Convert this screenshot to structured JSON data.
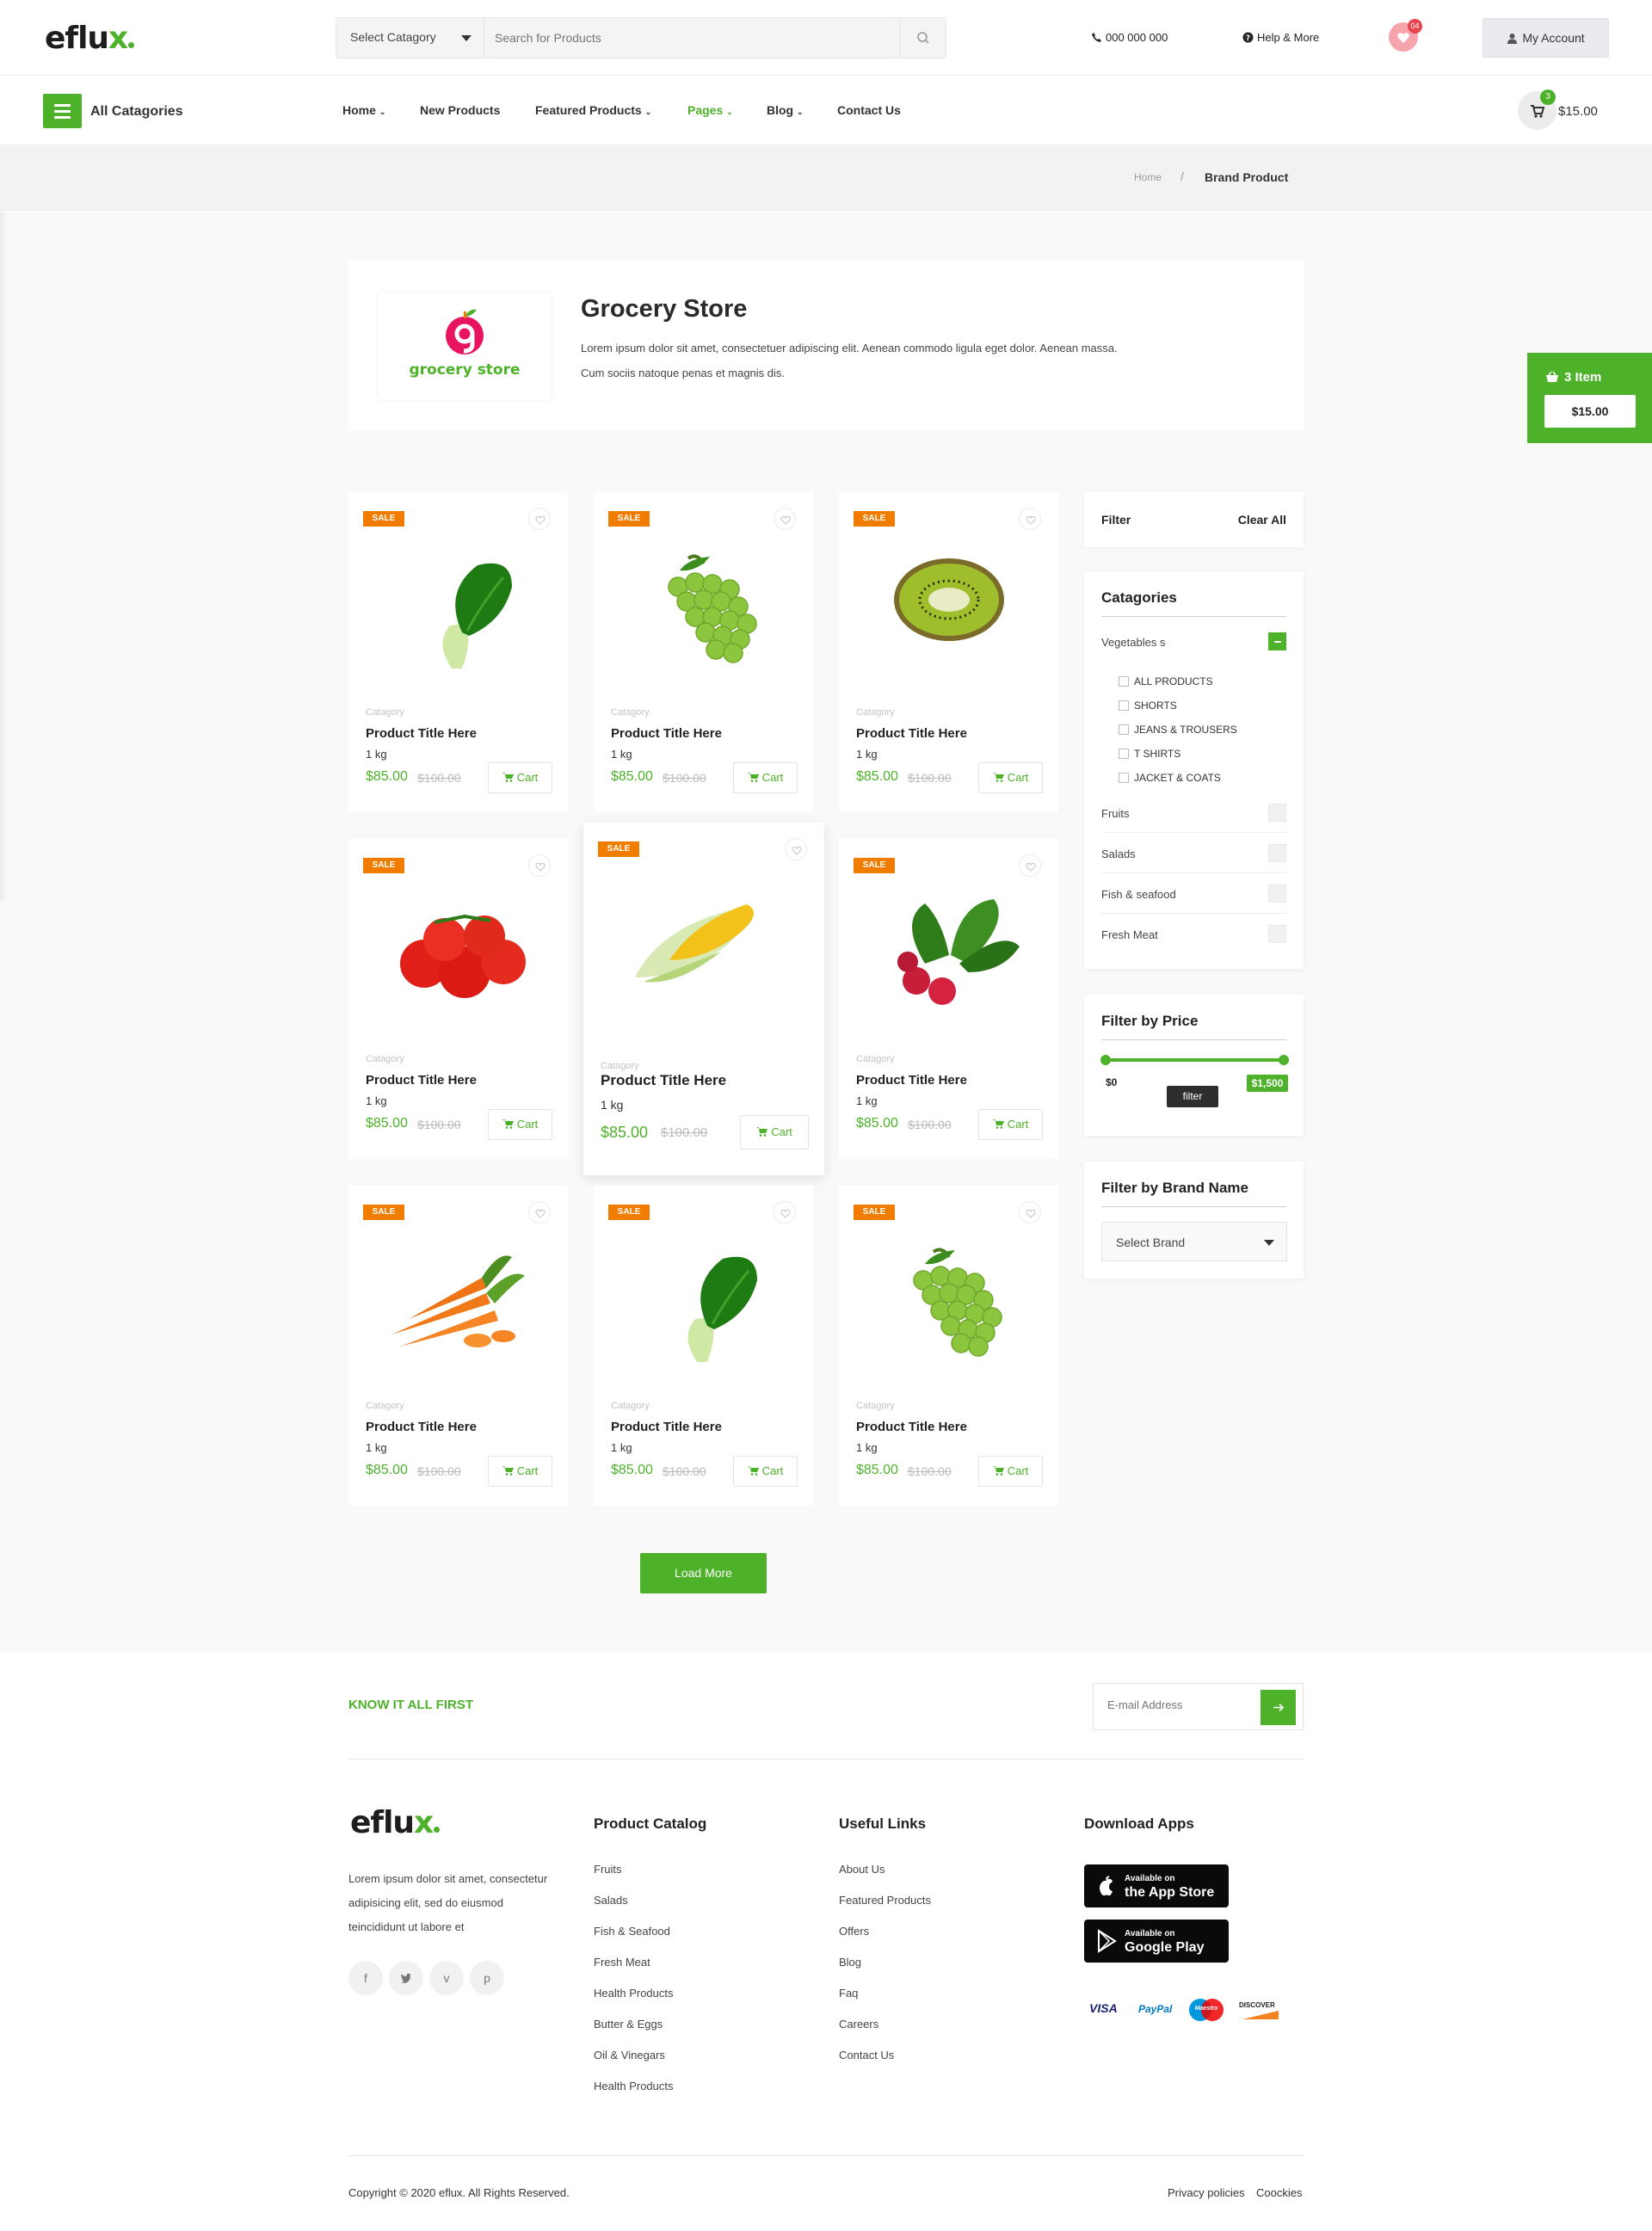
{
  "header": {
    "logo": {
      "text": "eflu",
      "accent": "x"
    },
    "search": {
      "category_label": "Select Catagory",
      "placeholder": "Search for Products"
    },
    "phone": "000 000 000",
    "help": "Help & More",
    "wishlist_count": "04",
    "account": "My Account"
  },
  "nav": {
    "all_categories": "All Catagories",
    "items": [
      {
        "label": "Home"
      },
      {
        "label": "New Products"
      },
      {
        "label": "Featured Products"
      },
      {
        "label": "Pages"
      },
      {
        "label": "Blog"
      },
      {
        "label": "Contact Us"
      }
    ],
    "cart_count": "3",
    "cart_total": "$15.00"
  },
  "breadcrumb": {
    "home": "Home",
    "separator": "/",
    "current": "Brand Product"
  },
  "store": {
    "logo_text": "grocery store",
    "logo_letter": "g",
    "title": "Grocery Store",
    "description": "Lorem ipsum dolor sit amet, consectetuer adipiscing elit. Aenean commodo ligula eget dolor. Aenean massa. Cum sociis natoque penas et magnis dis."
  },
  "side_cart": {
    "items": "3 Item",
    "total": "$15.00"
  },
  "products": [
    {
      "badge": "SALE",
      "category": "Catagory",
      "title": "Product Title Here",
      "weight": "1 kg",
      "price": "$85.00",
      "old_price": "$100.00",
      "cart": "Cart",
      "image": "spinach"
    },
    {
      "badge": "SALE",
      "category": "Catagory",
      "title": "Product Title Here",
      "weight": "1 kg",
      "price": "$85.00",
      "old_price": "$100.00",
      "cart": "Cart",
      "image": "grapes"
    },
    {
      "badge": "SALE",
      "category": "Catagory",
      "title": "Product Title Here",
      "weight": "1 kg",
      "price": "$85.00",
      "old_price": "$100.00",
      "cart": "Cart",
      "image": "kiwi"
    },
    {
      "badge": "SALE",
      "category": "Catagory",
      "title": "Product Title Here",
      "weight": "1 kg",
      "price": "$85.00",
      "old_price": "$100.00",
      "cart": "Cart",
      "image": "tomatoes"
    },
    {
      "badge": "SALE",
      "category": "Catagory",
      "title": "Product Title Here",
      "weight": "1 kg",
      "price": "$85.00",
      "old_price": "$100.00",
      "cart": "Cart",
      "image": "corn"
    },
    {
      "badge": "SALE",
      "category": "Catagory",
      "title": "Product Title Here",
      "weight": "1 kg",
      "price": "$85.00",
      "old_price": "$100.00",
      "cart": "Cart",
      "image": "radish"
    },
    {
      "badge": "SALE",
      "category": "Catagory",
      "title": "Product Title Here",
      "weight": "1 kg",
      "price": "$85.00",
      "old_price": "$100.00",
      "cart": "Cart",
      "image": "carrots"
    },
    {
      "badge": "SALE",
      "category": "Catagory",
      "title": "Product Title Here",
      "weight": "1 kg",
      "price": "$85.00",
      "old_price": "$100.00",
      "cart": "Cart",
      "image": "spinach"
    },
    {
      "badge": "SALE",
      "category": "Catagory",
      "title": "Product Title Here",
      "weight": "1 kg",
      "price": "$85.00",
      "old_price": "$100.00",
      "cart": "Cart",
      "image": "grapes"
    }
  ],
  "filter": {
    "label": "Filter",
    "clear": "Clear All"
  },
  "categories": {
    "title": "Catagories",
    "expanded": {
      "label": "Vegetables s",
      "sub": [
        "ALL PRODUCTS",
        "SHORTS",
        "JEANS & TROUSERS",
        "T SHIRTS",
        "JACKET & COATS"
      ]
    },
    "others": [
      "Fruits",
      "Salads",
      "Fish & seafood",
      "Fresh Meat"
    ]
  },
  "price_filter": {
    "title": "Filter by Price",
    "min": "$0",
    "max": "$1,500",
    "button": "filter"
  },
  "brand_filter": {
    "title": "Filter by Brand Name",
    "select": "Select Brand"
  },
  "load_more": "Load More",
  "footer": {
    "newsletter": {
      "label": "KNOW IT ALL FIRST",
      "placeholder": "E-mail Address"
    },
    "about": "Lorem ipsum dolor sit amet, consectetur adipisicing elit, sed do eiusmod teincididunt ut labore et",
    "catalog": {
      "title": "Product Catalog",
      "links": [
        "Fruits",
        "Salads",
        "Fish & Seafood",
        "Fresh Meat",
        "Health Products",
        "Butter & Eggs",
        "Oil & Vinegars",
        "Health Products"
      ]
    },
    "useful": {
      "title": "Useful Links",
      "links": [
        "About Us",
        "Featured Products",
        "Offers",
        "Blog",
        "Faq",
        "Careers",
        "Contact Us"
      ]
    },
    "apps": {
      "title": "Download Apps",
      "appstore": {
        "small": "Available on",
        "large": "the App Store"
      },
      "google": {
        "small": "Available on",
        "large": "Google Play"
      }
    },
    "payments": [
      "VISA",
      "PayPal",
      "Maestro",
      "DISCOVER"
    ],
    "copyright": "Copyright © 2020 eflux. All Rights Reserved.",
    "privacy": "Privacy policies",
    "cookies": "Coockies"
  },
  "colors": {
    "accent": "#4db12a",
    "sale": "#f07c00",
    "wishlist": "#f7a5ad"
  }
}
